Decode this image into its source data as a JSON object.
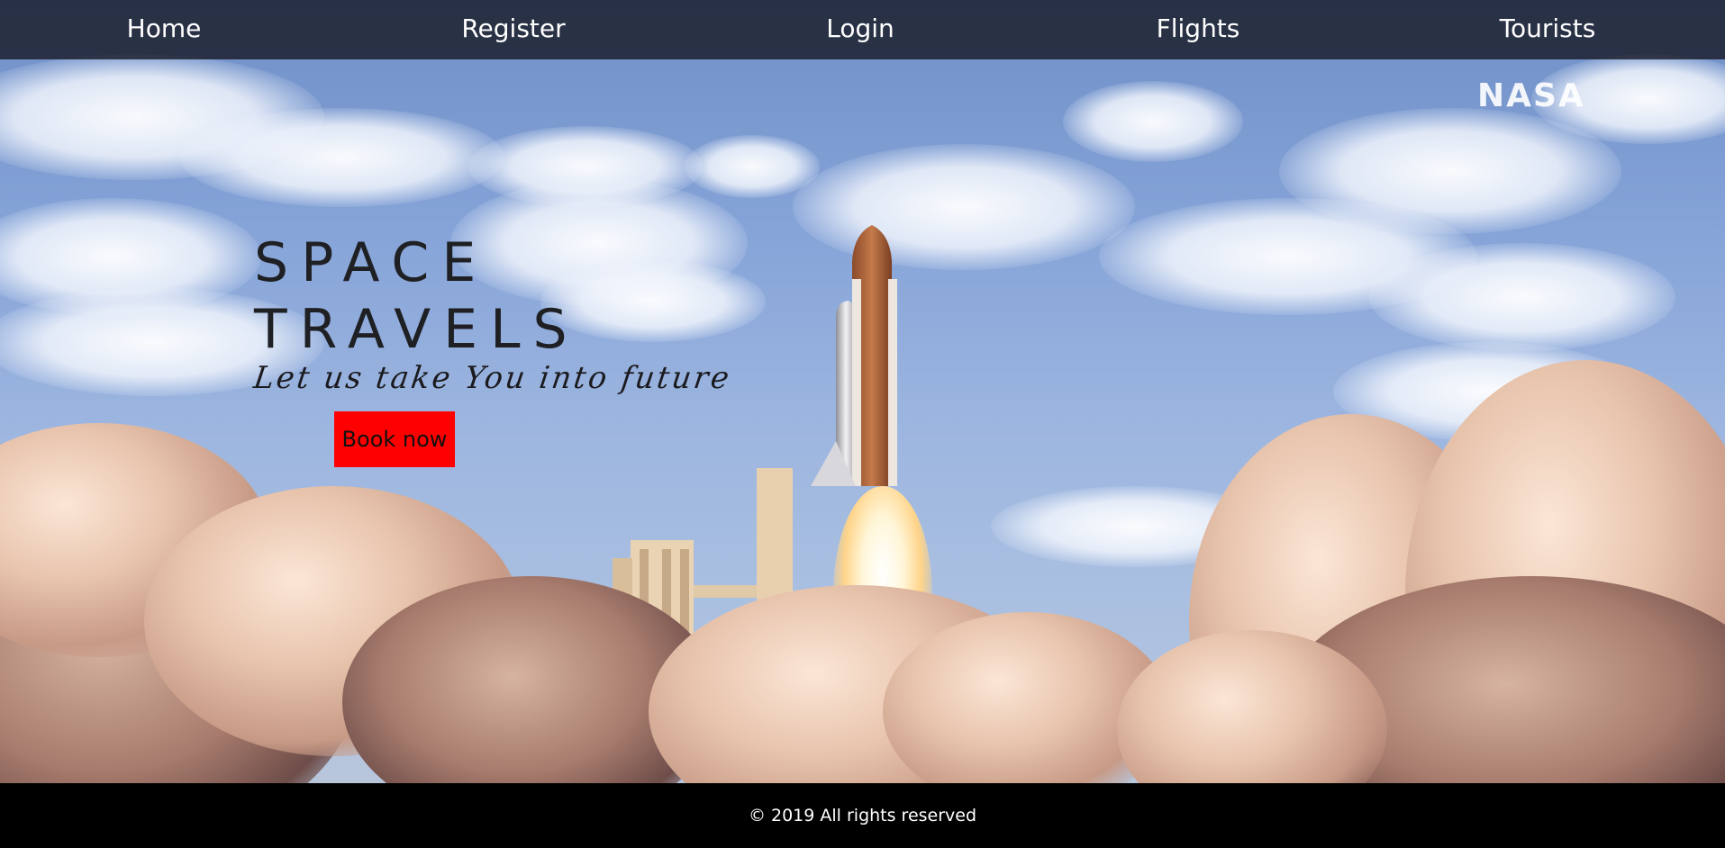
{
  "nav": {
    "items": [
      {
        "label": "Home"
      },
      {
        "label": "Register"
      },
      {
        "label": "Login"
      },
      {
        "label": "Flights"
      },
      {
        "label": "Tourists"
      }
    ]
  },
  "hero": {
    "title_line1": "SPACE",
    "title_line2": "TRAVELS",
    "tagline": "Let us take You into future",
    "book_label": "Book now",
    "logo_text": "NASA"
  },
  "footer": {
    "text": "© 2019 All rights reserved"
  },
  "colors": {
    "navbar": "#1f2230",
    "button": "#ff0000",
    "footer": "#000000"
  }
}
